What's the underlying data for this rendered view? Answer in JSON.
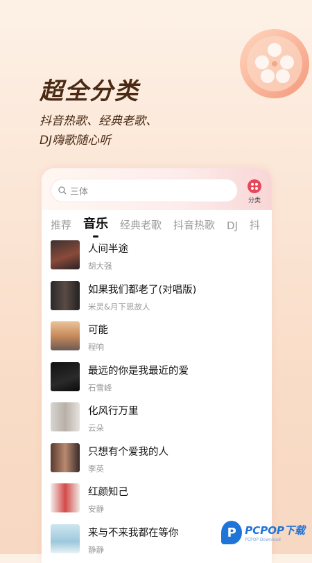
{
  "promo": {
    "headline": "超全分类",
    "sub_line1": "抖音热歌、经典老歌、",
    "sub_line2": "DJ嗨歌随心听"
  },
  "search": {
    "placeholder": "三体"
  },
  "category": {
    "label": "分类",
    "icon": "category-dots-icon"
  },
  "tabs": [
    {
      "label": "推荐"
    },
    {
      "label": "音乐",
      "active": true
    },
    {
      "label": "经典老歌"
    },
    {
      "label": "抖音热歌"
    },
    {
      "label": "DJ"
    },
    {
      "label": "抖"
    }
  ],
  "songs": [
    {
      "title": "人间半途",
      "artist": "胡大强"
    },
    {
      "title": "如果我们都老了(对唱版)",
      "artist": "米灵&月下思故人"
    },
    {
      "title": "可能",
      "artist": "程响"
    },
    {
      "title": "最远的你是我最近的爱",
      "artist": "石雪峰"
    },
    {
      "title": "化风行万里",
      "artist": "云朵"
    },
    {
      "title": "只想有个爱我的人",
      "artist": "李英"
    },
    {
      "title": "红颜知己",
      "artist": "安静"
    },
    {
      "title": "来与不来我都在等你",
      "artist": "静静"
    }
  ],
  "watermark": {
    "brand": "PCPOP下载",
    "sub": "PCPOP Download",
    "logo_letter": "P"
  },
  "colors": {
    "accent": "#e8475a",
    "headline": "#4a2a14",
    "watermark": "#1f74d8"
  }
}
